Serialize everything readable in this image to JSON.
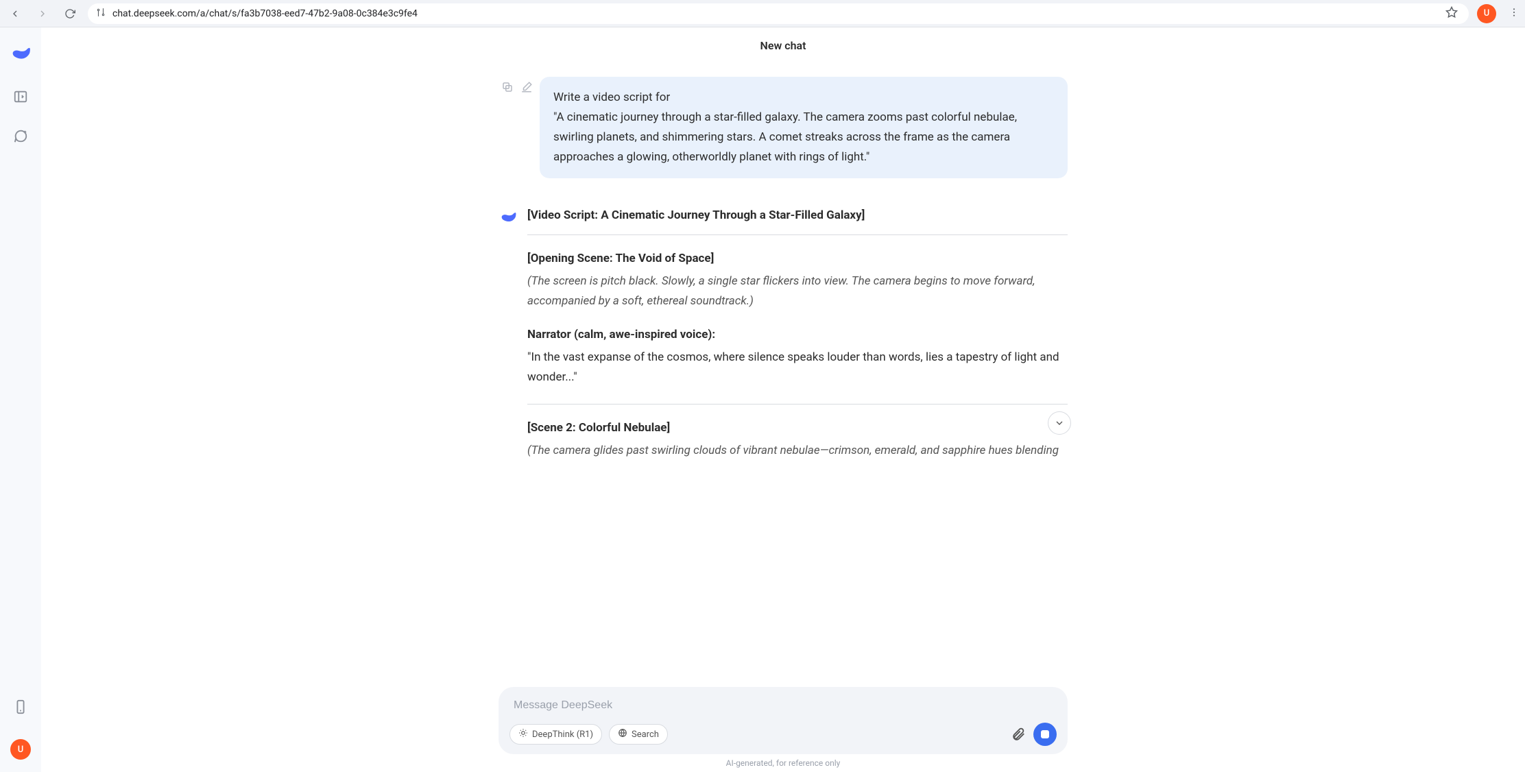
{
  "browser": {
    "url": "chat.deepseek.com/a/chat/s/fa3b7038-eed7-47b2-9a08-0c384e3c9fe4",
    "avatar_initial": "U"
  },
  "sidebar": {
    "avatar_initial": "U"
  },
  "header": {
    "title": "New chat"
  },
  "user_message": {
    "line1": "Write a video script for",
    "line2": "\"A cinematic journey through a star-filled galaxy. The camera zooms past colorful nebulae, swirling planets, and shimmering stars. A comet streaks across the frame as the camera approaches a glowing, otherworldly planet with rings of light.\""
  },
  "assistant": {
    "title": "[Video Script: A Cinematic Journey Through a Star-Filled Galaxy]",
    "opening_scene_title": "[Opening Scene: The Void of Space]",
    "opening_scene_desc": "(The screen is pitch black. Slowly, a single star flickers into view. The camera begins to move forward, accompanied by a soft, ethereal soundtrack.)",
    "narrator_label": "Narrator (calm, awe-inspired voice):",
    "narrator_line": "\"In the vast expanse of the cosmos, where silence speaks louder than words, lies a tapestry of light and wonder...\"",
    "scene2_title": "[Scene 2: Colorful Nebulae]",
    "scene2_desc": "(The camera glides past swirling clouds of vibrant nebulae—crimson, emerald, and sapphire hues blending"
  },
  "composer": {
    "placeholder": "Message DeepSeek",
    "deepthink_label": "DeepThink (R1)",
    "search_label": "Search"
  },
  "footer": {
    "note": "AI-generated, for reference only"
  }
}
